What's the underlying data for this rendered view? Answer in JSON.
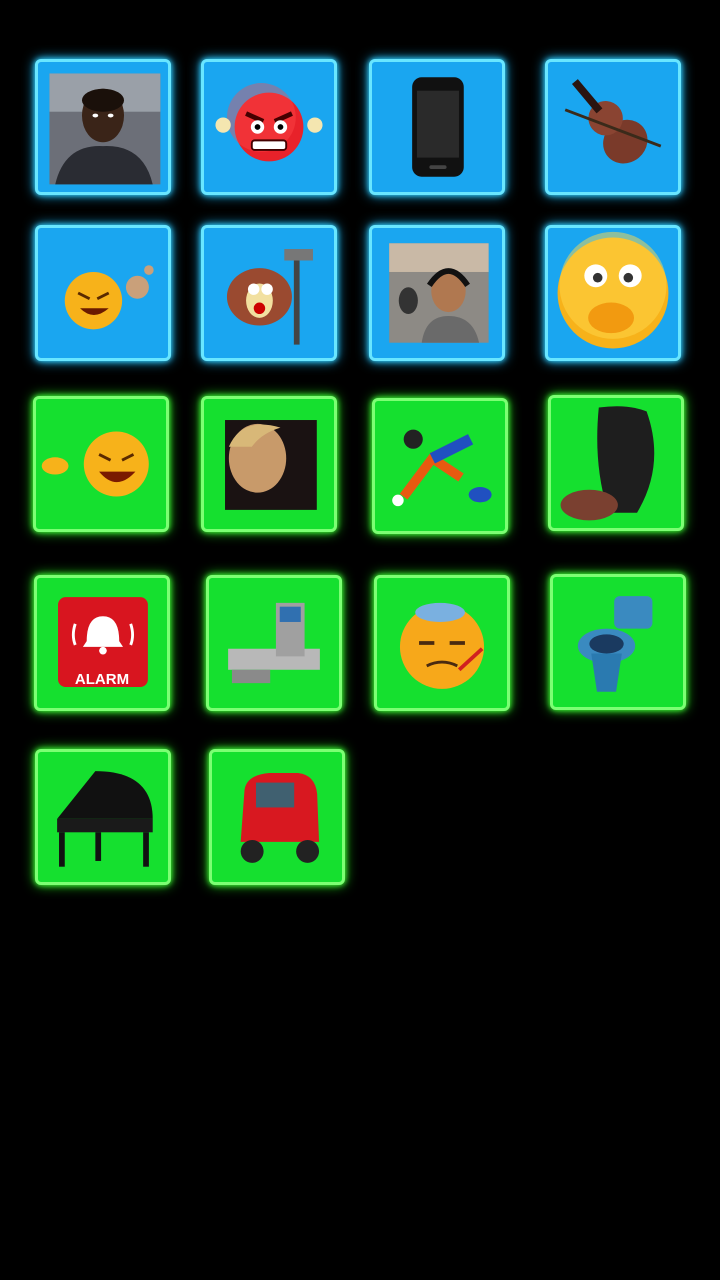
{
  "soundboard": {
    "buttons": [
      {
        "id": "man-talking",
        "icon": "man-portrait-icon",
        "color": "blue"
      },
      {
        "id": "angry-emoji",
        "icon": "angry-face-icon",
        "color": "blue"
      },
      {
        "id": "phone",
        "icon": "mobile-phone-icon",
        "color": "blue"
      },
      {
        "id": "violin",
        "icon": "violin-icon",
        "color": "blue"
      },
      {
        "id": "fart-emoji",
        "icon": "laughing-fart-emoji-icon",
        "color": "blue"
      },
      {
        "id": "coyote-hammer",
        "icon": "cartoon-coyote-hammer-icon",
        "color": "blue"
      },
      {
        "id": "radio-host",
        "icon": "man-with-headphones-icon",
        "color": "blue"
      },
      {
        "id": "shocked-emoji",
        "icon": "surprised-hand-mouth-emoji-icon",
        "color": "blue"
      },
      {
        "id": "laughing-pointing",
        "icon": "laughing-pointing-emoji-icon",
        "color": "green"
      },
      {
        "id": "blonde-person",
        "icon": "person-portrait-icon",
        "color": "green"
      },
      {
        "id": "goofy-falling",
        "icon": "cartoon-dog-falling-icon",
        "color": "green"
      },
      {
        "id": "hand-object",
        "icon": "hand-holding-object-icon",
        "color": "green"
      },
      {
        "id": "alarm",
        "icon": "alarm-bell-icon",
        "color": "green",
        "label": "ALARM"
      },
      {
        "id": "checkout",
        "icon": "self-checkout-machine-icon",
        "color": "green"
      },
      {
        "id": "sick-emoji",
        "icon": "sick-thermometer-emoji-icon",
        "color": "green"
      },
      {
        "id": "toilet",
        "icon": "toilet-icon",
        "color": "green"
      },
      {
        "id": "piano",
        "icon": "grand-piano-icon",
        "color": "green"
      },
      {
        "id": "mini-car",
        "icon": "red-microcar-icon",
        "color": "green"
      }
    ]
  },
  "colors": {
    "background": "#000000",
    "blue_tile": "#1aa6f0",
    "green_tile": "#15e02f"
  }
}
